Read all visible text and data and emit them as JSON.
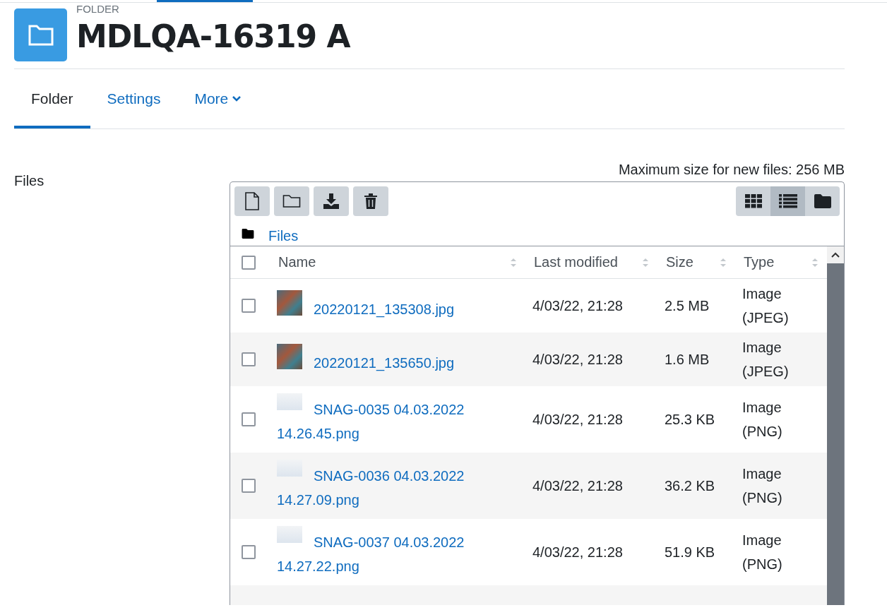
{
  "header": {
    "kind_label": "FOLDER",
    "title": "MDLQA-16319 A"
  },
  "tabs": [
    {
      "label": "Folder",
      "selected": true,
      "dropdown": false
    },
    {
      "label": "Settings",
      "selected": false,
      "dropdown": false
    },
    {
      "label": "More",
      "selected": false,
      "dropdown": true
    }
  ],
  "files_label": "Files",
  "max_size": "Maximum size for new files: 256 MB",
  "view_buttons": [
    {
      "kind": "icons",
      "selected": false
    },
    {
      "kind": "list",
      "selected": true
    },
    {
      "kind": "tree",
      "selected": false
    }
  ],
  "breadcrumb": "Files",
  "columns": [
    "Name",
    "Last modified",
    "Size",
    "Type"
  ],
  "select_all_checked": false,
  "files": [
    {
      "name": "20220121_135308.jpg",
      "modified": "4/03/22, 21:28",
      "size": "2.5 MB",
      "type": "Image (JPEG)",
      "kind": "photo",
      "checked": false
    },
    {
      "name": "20220121_135650.jpg",
      "modified": "4/03/22, 21:28",
      "size": "1.6 MB",
      "type": "Image (JPEG)",
      "kind": "photo",
      "checked": false
    },
    {
      "name": "SNAG-0035 04.03.2022 14.26.45.png",
      "modified": "4/03/22, 21:28",
      "size": "25.3 KB",
      "type": "Image (PNG)",
      "kind": "screenshot",
      "checked": false
    },
    {
      "name": "SNAG-0036 04.03.2022 14.27.09.png",
      "modified": "4/03/22, 21:28",
      "size": "36.2 KB",
      "type": "Image (PNG)",
      "kind": "screenshot",
      "checked": false
    },
    {
      "name": "SNAG-0037 04.03.2022 14.27.22.png",
      "modified": "4/03/22, 21:28",
      "size": "51.9 KB",
      "type": "Image (PNG)",
      "kind": "screenshot",
      "checked": false
    }
  ]
}
